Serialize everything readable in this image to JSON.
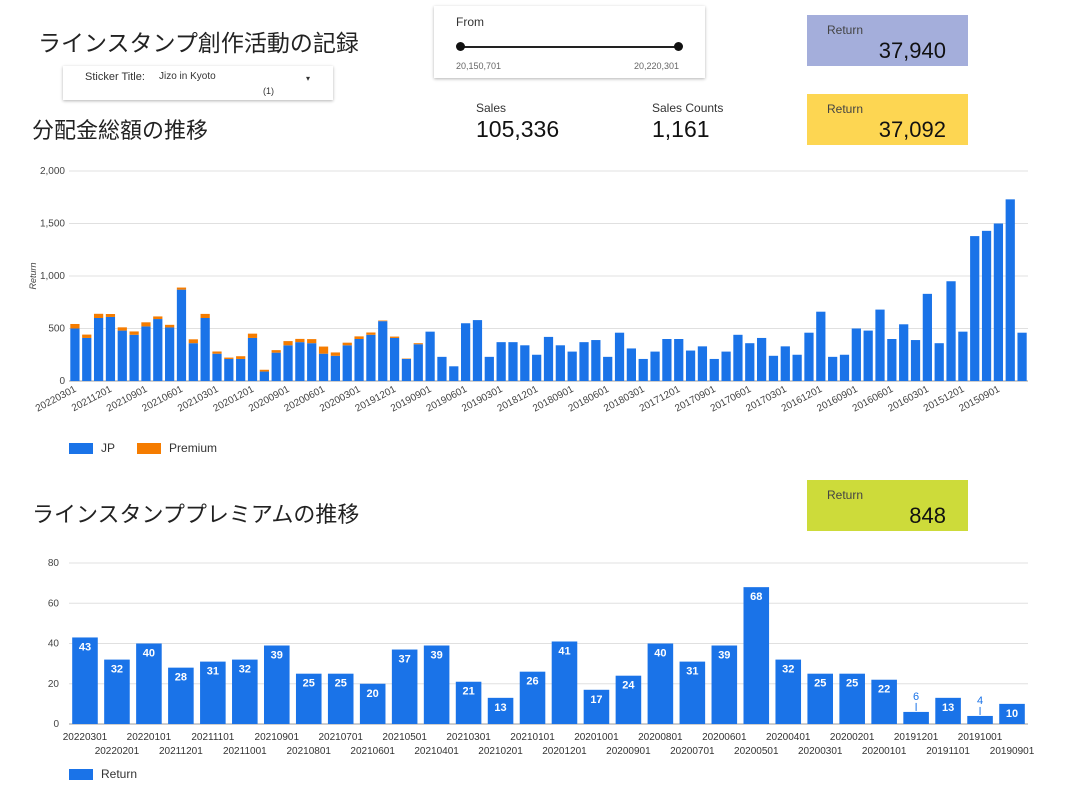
{
  "page_title": "ラインスタンプ創作活動の記録",
  "sticker_filter": {
    "label": "Sticker Title:",
    "value": "Jizo in Kyoto",
    "count": "(1)"
  },
  "slider": {
    "label": "From",
    "min_label": "20,150,701",
    "max_label": "20,220,301"
  },
  "cards": {
    "top": {
      "label": "Return",
      "value": "37,940"
    },
    "mid": {
      "label": "Return",
      "value": "37,092"
    },
    "premium": {
      "label": "Return",
      "value": "848"
    }
  },
  "kpis": {
    "sales": {
      "label": "Sales",
      "value": "105,336"
    },
    "counts": {
      "label": "Sales Counts",
      "value": "1,161"
    }
  },
  "colors": {
    "jp": "#1a73e8",
    "premium": "#f57c00",
    "card_top": "#a4aedb",
    "card_mid": "#fdd652",
    "card_premium": "#cddb3a"
  },
  "section1_title": "分配金総額の推移",
  "section2_title": "ラインスタンププレミアムの推移",
  "chart_data": [
    {
      "type": "bar",
      "stacked": true,
      "ylabel": "Return",
      "ylim": [
        0,
        2000
      ],
      "yticks": [
        "0",
        "500",
        "1,000",
        "1,500",
        "2,000"
      ],
      "ytick_values": [
        0,
        500,
        1000,
        1500,
        2000
      ],
      "grid": true,
      "legend": "bottom-left",
      "x_tick_labels": [
        "20220301",
        "20211201",
        "20210901",
        "20210601",
        "20210301",
        "20201201",
        "20200901",
        "20200601",
        "20200301",
        "20191201",
        "20190901",
        "20190601",
        "20190301",
        "20181201",
        "20180901",
        "20180601",
        "20180301",
        "20171201",
        "20170901",
        "20170601",
        "20170301",
        "20161201",
        "20160901",
        "20160601",
        "20160301",
        "20151201",
        "20150901"
      ],
      "series": [
        {
          "name": "JP",
          "values": [
            500,
            410,
            600,
            610,
            480,
            440,
            520,
            590,
            510,
            870,
            360,
            600,
            260,
            210,
            210,
            410,
            90,
            270,
            340,
            370,
            360,
            260,
            240,
            340,
            400,
            440,
            570,
            410,
            210,
            350,
            470,
            230,
            140,
            550,
            580,
            230,
            370,
            370,
            340,
            250,
            420,
            340,
            280,
            370,
            390,
            230,
            460,
            310,
            210,
            280,
            400,
            400,
            290,
            330,
            210,
            280,
            440,
            360,
            410,
            240,
            330,
            250,
            460,
            660,
            230,
            250,
            500,
            480,
            680,
            400,
            540,
            390,
            830,
            360,
            950,
            470,
            1380,
            1430,
            1500,
            1730,
            460
          ]
        },
        {
          "name": "Premium",
          "values": [
            43,
            32,
            40,
            28,
            31,
            32,
            39,
            25,
            25,
            20,
            37,
            39,
            21,
            13,
            26,
            41,
            17,
            24,
            40,
            31,
            39,
            68,
            32,
            25,
            25,
            22,
            6,
            13,
            4,
            10,
            0,
            0,
            0,
            0,
            0,
            0,
            0,
            0,
            0,
            0,
            0,
            0,
            0,
            0,
            0,
            0,
            0,
            0,
            0,
            0,
            0,
            0,
            0,
            0,
            0,
            0,
            0,
            0,
            0,
            0,
            0,
            0,
            0,
            0,
            0,
            0,
            0,
            0,
            0,
            0,
            0,
            0,
            0,
            0,
            0,
            0,
            0,
            0,
            0,
            0,
            0
          ]
        }
      ]
    },
    {
      "type": "bar",
      "ylim": [
        0,
        80
      ],
      "yticks": [
        "0",
        "20",
        "40",
        "60",
        "80"
      ],
      "ytick_values": [
        0,
        20,
        40,
        60,
        80
      ],
      "grid": true,
      "legend": "bottom-left",
      "categories": [
        "20220301",
        "20220201",
        "20220101",
        "20211201",
        "20211101",
        "20211001",
        "20210901",
        "20210801",
        "20210701",
        "20210601",
        "20210501",
        "20210401",
        "20210301",
        "20210201",
        "20210101",
        "20201201",
        "20201001",
        "20200901",
        "20200801",
        "20200701",
        "20200601",
        "20200501",
        "20200401",
        "20200301",
        "20200201",
        "20200101",
        "20191201",
        "20191101",
        "20191001",
        "20190901"
      ],
      "series": [
        {
          "name": "Return",
          "values": [
            43,
            32,
            40,
            28,
            31,
            32,
            39,
            25,
            25,
            20,
            37,
            39,
            21,
            13,
            26,
            41,
            17,
            24,
            40,
            31,
            39,
            68,
            32,
            25,
            25,
            22,
            6,
            13,
            4,
            10
          ]
        }
      ]
    }
  ],
  "legend1": {
    "jp": "JP",
    "premium": "Premium"
  },
  "legend2": {
    "ret": "Return"
  }
}
